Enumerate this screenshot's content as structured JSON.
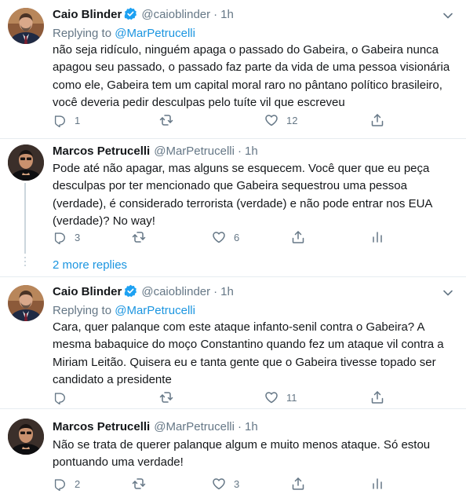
{
  "tweets": [
    {
      "name": "Caio Blinder",
      "handle": "@caioblinder",
      "separator": "·",
      "time": "1h",
      "replying_prefix": "Replying to ",
      "replying_to": "@MarPetrucelli",
      "text": "não seja ridículo, ninguém apaga o passado do Gabeira, o Gabeira nunca apagou seu passado, o passado faz parte da vida de uma pessoa visionária como ele, Gabeira tem um capital moral raro no pântano político brasileiro, você deveria pedir desculpas pelo tuíte vil que escreveu",
      "replies": "1",
      "retweets": "",
      "likes": "12"
    },
    {
      "name": "Marcos Petrucelli",
      "handle": "@MarPetrucelli",
      "separator": "·",
      "time": "1h",
      "text": "Pode até não apagar, mas alguns se esquecem. Você quer que eu peça desculpas por ter mencionado que Gabeira sequestrou uma pessoa (verdade), é considerado terrorista (verdade) e não pode entrar nos EUA (verdade)? No way!",
      "replies": "3",
      "retweets": "",
      "likes": "6"
    },
    {
      "name": "Caio Blinder",
      "handle": "@caioblinder",
      "separator": "·",
      "time": "1h",
      "replying_prefix": "Replying to ",
      "replying_to": "@MarPetrucelli",
      "text": "Cara, quer palanque com este ataque infanto-senil contra o Gabeira? A mesma babaquice do moço Constantino quando fez um ataque vil contra a Miriam Leitão. Quisera eu e tanta gente que o Gabeira tivesse topado ser candidato a presidente",
      "replies": "",
      "retweets": "",
      "likes": "11"
    },
    {
      "name": "Marcos Petrucelli",
      "handle": "@MarPetrucelli",
      "separator": "·",
      "time": "1h",
      "text": "Não se trata de querer palanque algum e muito menos ataque. Só estou pontuando uma verdade!",
      "replies": "2",
      "retweets": "",
      "likes": "3"
    }
  ],
  "more_replies": "2 more replies",
  "colors": {
    "text": "#14171a",
    "secondary": "#657786",
    "link": "#1b95e0",
    "divider": "#e6ecf0",
    "thread_line": "#ccd6dd"
  },
  "icons": [
    "reply-icon",
    "retweet-icon",
    "like-icon",
    "share-icon",
    "analytics-icon",
    "verified-badge-icon",
    "chevron-down-icon"
  ]
}
